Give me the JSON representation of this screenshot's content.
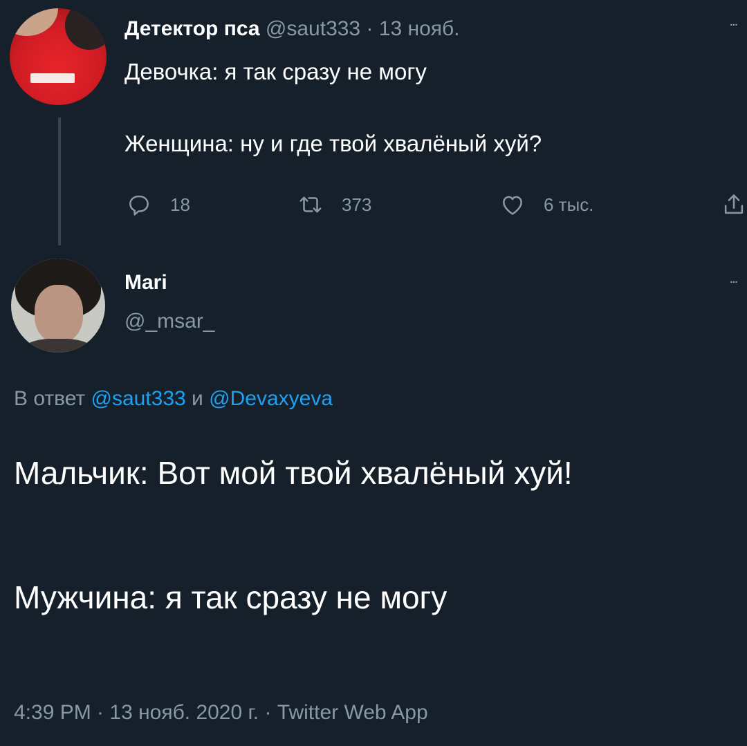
{
  "tweet1": {
    "name": "Детектор пса",
    "handle": "@saut333",
    "separator": " · ",
    "date": "13 нояб.",
    "lines": [
      "Девочка: я так сразу не могу",
      "Женщина: ну и где твой хвалёный хуй?"
    ],
    "replies": "18",
    "retweets": "373",
    "likes": "6 тыс."
  },
  "tweet2": {
    "name": "Mari",
    "handle": "@_msar_",
    "reply_prefix": "В ответ ",
    "reply_mention_1": "@saut333",
    "reply_and": " и ",
    "reply_mention_2": "@Devaxyeva",
    "lines": [
      "Мальчик: Вот мой твой хвалёный хуй!",
      "Мужчина: я так сразу не могу"
    ],
    "footer": "4:39 PM · 13 нояб. 2020 г. · Twitter Web App"
  },
  "more_icon_glyph": "ᐧᐧᐧ",
  "colors": {
    "background": "#15202b",
    "text": "#ffffff",
    "secondary": "#8899a6",
    "link": "#1da1f2",
    "thread_line": "#38444d"
  },
  "icons": [
    "reply-icon",
    "retweet-icon",
    "like-icon",
    "share-icon",
    "more-icon"
  ]
}
